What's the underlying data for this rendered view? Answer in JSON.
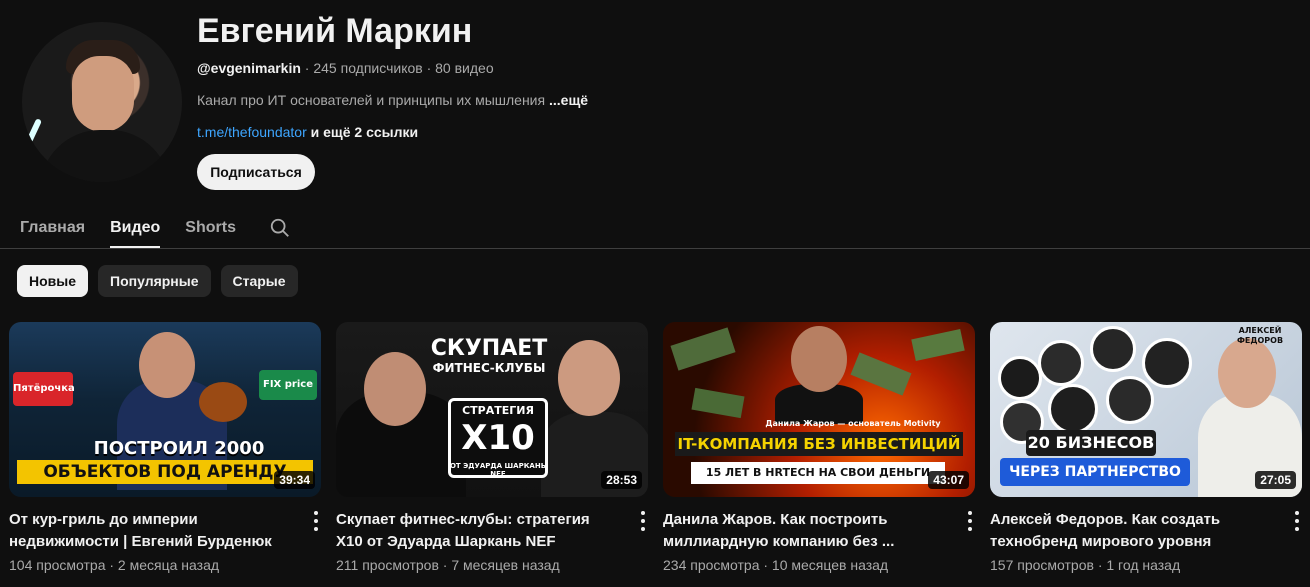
{
  "channel": {
    "name": "Евгений Маркин",
    "handle": "@evgenimarkin",
    "stats": " · 245 подписчиков · 80 видео",
    "description": "Канал про ИТ основателей и принципы их мышления ",
    "description_more": "...ещё",
    "link": "t.me/thefoundator",
    "link_rest": " и ещё 2 ссылки",
    "subscribe_label": "Подписаться"
  },
  "tabs": [
    {
      "label": "Главная"
    },
    {
      "label": "Видео"
    },
    {
      "label": "Shorts"
    }
  ],
  "chips": [
    {
      "label": "Новые"
    },
    {
      "label": "Популярные"
    },
    {
      "label": "Старые"
    }
  ],
  "videos": [
    {
      "title": "От кур-гриль до империи недвижимости | Евгений Бурденюк",
      "meta": "104 просмотра · 2 месяца назад",
      "duration": "39:34",
      "thumb_text_1": "ПОСТРОИЛ 2000",
      "thumb_text_2": "ОБЪЕКТОВ ПОД АРЕНДУ",
      "store_1": "Пятёрочка",
      "store_2": "FIX price"
    },
    {
      "title": "Скупает фитнес-клубы: стратегия X10 от Эдуарда Шаркань NEF",
      "meta": "211 просмотров · 7 месяцев назад",
      "duration": "28:53",
      "thumb_text_1": "СКУПАЕТ",
      "thumb_text_2": "ФИТНЕС-КЛУБЫ",
      "thumb_text_3": "СТРАТЕГИЯ",
      "thumb_text_4": "X10",
      "thumb_text_5": "ОТ ЭДУАРДА ШАРКАНЬ NEF"
    },
    {
      "title": "Данила Жаров. Как построить миллиардную компанию без ...",
      "meta": "234 просмотра · 10 месяцев назад",
      "duration": "43:07",
      "thumb_text_1": "Данила Жаров — основатель Motivity",
      "thumb_text_2": "IT-КОМПАНИЯ БЕЗ ИНВЕСТИЦИЙ",
      "thumb_text_3": "15 ЛЕТ В HRTECH НА СВОИ ДЕНЬГИ"
    },
    {
      "title": "Алексей Федоров. Как создать технобренд мирового уровня",
      "meta": "157 просмотров · 1 год назад",
      "duration": "27:05",
      "thumb_text_1": "АЛЕКСЕЙ ФЕДОРОВ",
      "thumb_text_2": "20 БИЗНЕСОВ",
      "thumb_text_3": "ЧЕРЕЗ ПАРТНЕРСТВО"
    }
  ],
  "colors": {
    "background": "#0f0f0f",
    "text": "#f1f1f1",
    "secondary": "#aaaaaa",
    "link": "#3ea6ff",
    "chip": "#272727"
  }
}
